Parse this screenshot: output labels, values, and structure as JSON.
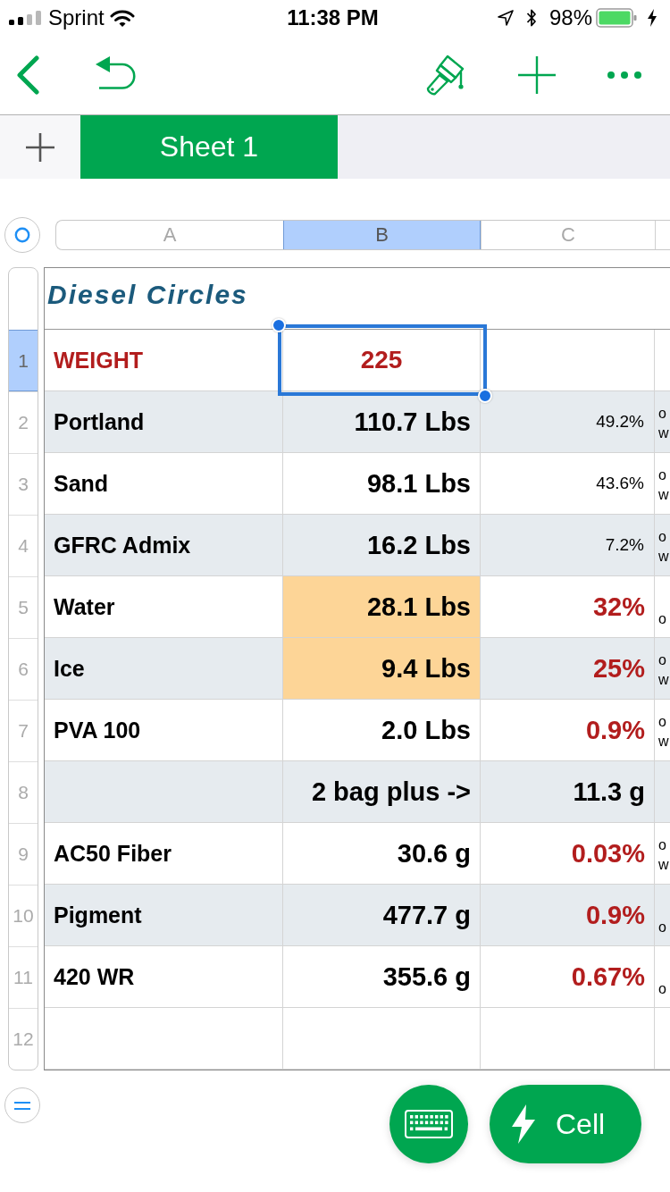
{
  "status_bar": {
    "carrier": "Sprint",
    "time": "11:38 PM",
    "battery": "98%"
  },
  "sheet_tabs": [
    {
      "label": "Sheet 1",
      "selected": true
    }
  ],
  "columns": [
    {
      "label": "A",
      "selected": false
    },
    {
      "label": "B",
      "selected": true
    },
    {
      "label": "C",
      "selected": false
    }
  ],
  "table": {
    "title": "Diesel Circles",
    "rows": [
      {
        "number": "1",
        "selected": true,
        "banded": false,
        "cells": [
          {
            "text": "WEIGHT",
            "kind": "label",
            "color": "#b21d1d",
            "highlighted": false,
            "selected": false
          },
          {
            "text": "225",
            "kind": "input",
            "color": "#b21d1d",
            "highlighted": false,
            "selected": true
          },
          {
            "highlighted": false,
            "selected": false
          }
        ]
      },
      {
        "number": "2",
        "selected": false,
        "banded": true,
        "cells": [
          {
            "text": "Portland",
            "kind": "label",
            "color": "#000000",
            "highlighted": false,
            "selected": false
          },
          {
            "text": "110.7 Lbs",
            "kind": "value",
            "color": "#000000",
            "highlighted": false,
            "selected": false
          },
          {
            "text": "49.2%",
            "kind": "note",
            "color": "#000000",
            "highlighted": false,
            "selected": false
          }
        ],
        "column_4": [
          "o",
          "w"
        ]
      },
      {
        "number": "3",
        "selected": false,
        "banded": false,
        "cells": [
          {
            "text": "Sand",
            "kind": "label",
            "color": "#000000",
            "highlighted": false,
            "selected": false
          },
          {
            "text": "98.1 Lbs",
            "kind": "value",
            "color": "#000000",
            "highlighted": false,
            "selected": false
          },
          {
            "text": "43.6%",
            "kind": "note",
            "color": "#000000",
            "highlighted": false,
            "selected": false
          }
        ],
        "column_4": [
          "o",
          "w"
        ]
      },
      {
        "number": "4",
        "selected": false,
        "banded": true,
        "cells": [
          {
            "text": "GFRC Admix",
            "kind": "label",
            "color": "#000000",
            "highlighted": false,
            "selected": false
          },
          {
            "text": "16.2 Lbs",
            "kind": "value",
            "color": "#000000",
            "highlighted": false,
            "selected": false
          },
          {
            "text": "7.2%",
            "kind": "note",
            "color": "#000000",
            "highlighted": false,
            "selected": false
          }
        ],
        "column_4": [
          "o",
          "w"
        ]
      },
      {
        "number": "5",
        "selected": false,
        "banded": false,
        "cells": [
          {
            "text": "Water",
            "kind": "label",
            "color": "#000000",
            "highlighted": false,
            "selected": false
          },
          {
            "text": "28.1 Lbs",
            "kind": "value",
            "color": "#000000",
            "highlighted": true,
            "selected": false
          },
          {
            "text": "32%",
            "kind": "value",
            "color": "#b21d1d",
            "highlighted": false,
            "selected": false
          }
        ],
        "column_4": [
          "o"
        ]
      },
      {
        "number": "6",
        "selected": false,
        "banded": true,
        "cells": [
          {
            "text": "Ice",
            "kind": "label",
            "color": "#000000",
            "highlighted": false,
            "selected": false
          },
          {
            "text": "9.4 Lbs",
            "kind": "value",
            "color": "#000000",
            "highlighted": true,
            "selected": false
          },
          {
            "text": "25%",
            "kind": "value",
            "color": "#b21d1d",
            "highlighted": false,
            "selected": false
          }
        ],
        "column_4": [
          "o",
          "w"
        ]
      },
      {
        "number": "7",
        "selected": false,
        "banded": false,
        "cells": [
          {
            "text": "PVA 100",
            "kind": "label",
            "color": "#000000",
            "highlighted": false,
            "selected": false
          },
          {
            "text": "2.0 Lbs",
            "kind": "value",
            "color": "#000000",
            "highlighted": false,
            "selected": false
          },
          {
            "text": "0.9%",
            "kind": "value",
            "color": "#b21d1d",
            "highlighted": false,
            "selected": false
          }
        ],
        "column_4": [
          "o",
          "w"
        ]
      },
      {
        "number": "8",
        "selected": false,
        "banded": true,
        "cells": [
          {
            "highlighted": false,
            "selected": false
          },
          {
            "text": "2 bag plus ->",
            "kind": "value",
            "color": "#000000",
            "highlighted": false,
            "selected": false
          },
          {
            "text": "11.3 g",
            "kind": "value",
            "color": "#000000",
            "highlighted": false,
            "selected": false
          }
        ]
      },
      {
        "number": "9",
        "selected": false,
        "banded": false,
        "cells": [
          {
            "text": "AC50 Fiber",
            "kind": "label",
            "color": "#000000",
            "highlighted": false,
            "selected": false
          },
          {
            "text": "30.6 g",
            "kind": "value",
            "color": "#000000",
            "highlighted": false,
            "selected": false
          },
          {
            "text": "0.03%",
            "kind": "value",
            "color": "#b21d1d",
            "highlighted": false,
            "selected": false
          }
        ],
        "column_4": [
          "o",
          "w"
        ]
      },
      {
        "number": "10",
        "selected": false,
        "banded": true,
        "cells": [
          {
            "text": "Pigment",
            "kind": "label",
            "color": "#000000",
            "highlighted": false,
            "selected": false
          },
          {
            "text": "477.7 g",
            "kind": "value",
            "color": "#000000",
            "highlighted": false,
            "selected": false
          },
          {
            "text": "0.9%",
            "kind": "value",
            "color": "#b21d1d",
            "highlighted": false,
            "selected": false
          }
        ],
        "column_4": [
          "o"
        ]
      },
      {
        "number": "11",
        "selected": false,
        "banded": false,
        "cells": [
          {
            "text": "420 WR",
            "kind": "label",
            "color": "#000000",
            "highlighted": false,
            "selected": false
          },
          {
            "text": "355.6 g",
            "kind": "value",
            "color": "#000000",
            "highlighted": false,
            "selected": false
          },
          {
            "text": "0.67%",
            "kind": "value",
            "color": "#b21d1d",
            "highlighted": false,
            "selected": false
          }
        ],
        "column_4": [
          "o"
        ]
      },
      {
        "number": "12",
        "selected": false,
        "banded": false,
        "cells": [
          {
            "highlighted": false,
            "selected": false
          },
          {
            "highlighted": false,
            "selected": false
          },
          {
            "highlighted": false,
            "selected": false
          }
        ]
      }
    ]
  },
  "action_button": {
    "label": "Cell"
  }
}
